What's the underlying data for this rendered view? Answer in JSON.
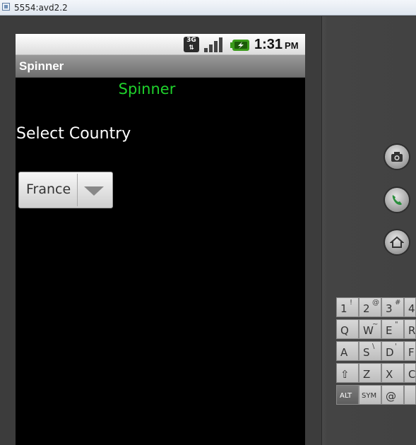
{
  "window": {
    "title": "5554:avd2.2"
  },
  "status_bar": {
    "network": "3G",
    "time": "1:31",
    "ampm": "PM"
  },
  "app": {
    "title": "Spinner",
    "heading": "Spinner",
    "label": "Select Country",
    "spinner": {
      "selected": "France"
    }
  },
  "keyboard": {
    "rows": [
      [
        {
          "main": "1",
          "alt": "!"
        },
        {
          "main": "2",
          "alt": "@"
        },
        {
          "main": "3",
          "alt": "#"
        },
        {
          "main": "4",
          "alt": ""
        }
      ],
      [
        {
          "main": "Q",
          "alt": ""
        },
        {
          "main": "W",
          "alt": "~"
        },
        {
          "main": "E",
          "alt": "\""
        },
        {
          "main": "R",
          "alt": ""
        }
      ],
      [
        {
          "main": "A",
          "alt": ""
        },
        {
          "main": "S",
          "alt": "\\"
        },
        {
          "main": "D",
          "alt": "'"
        },
        {
          "main": "F",
          "alt": ""
        }
      ],
      [
        {
          "main": "⇧",
          "alt": ""
        },
        {
          "main": "Z",
          "alt": ""
        },
        {
          "main": "X",
          "alt": ""
        },
        {
          "main": "C",
          "alt": ""
        }
      ],
      [
        {
          "main": "ALT",
          "alt": ""
        },
        {
          "main": "SYM",
          "alt": ""
        },
        {
          "main": "@",
          "alt": ""
        },
        {
          "main": "",
          "alt": ""
        }
      ]
    ]
  },
  "icons": {
    "camera": "camera-icon",
    "call": "call-icon",
    "home": "home-icon"
  },
  "colors": {
    "heading": "#1fd12c",
    "call": "#2a8f3c"
  }
}
